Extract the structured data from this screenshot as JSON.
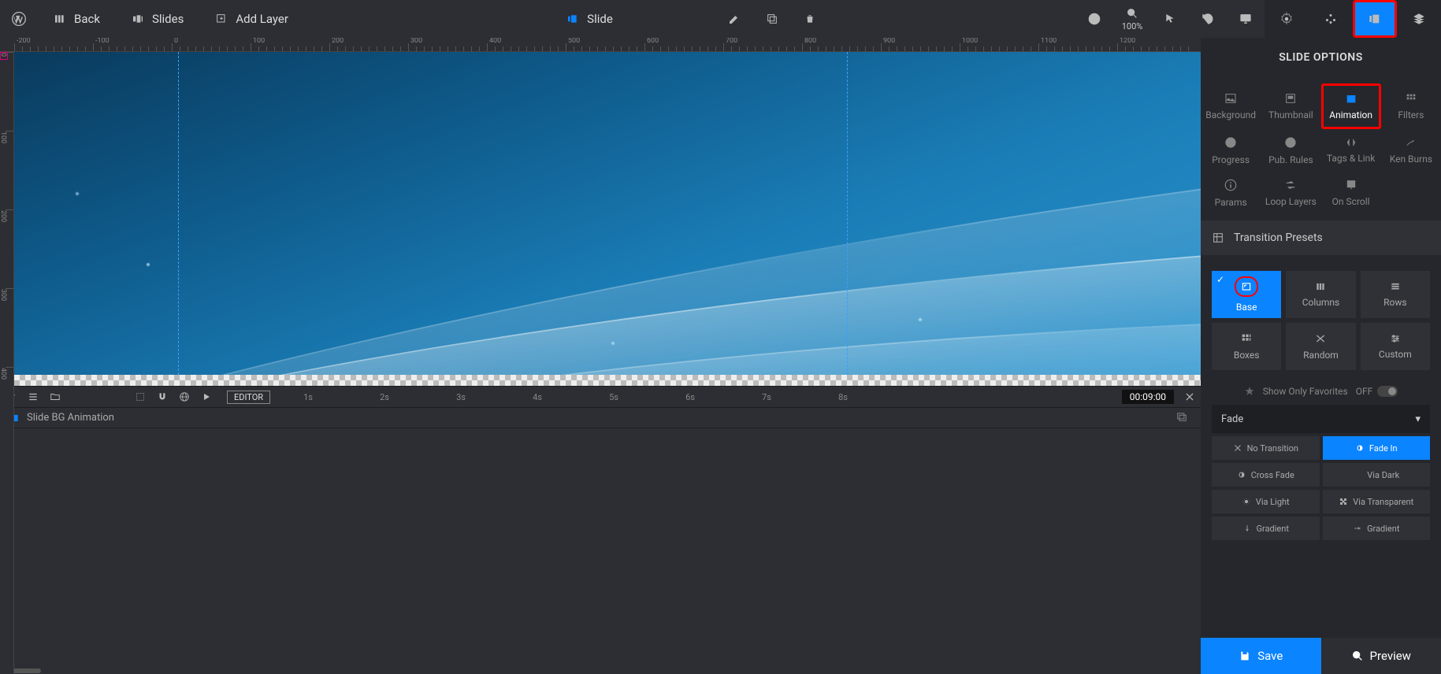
{
  "topbar": {
    "back": "Back",
    "slides": "Slides",
    "addLayer": "Add Layer",
    "slide": "Slide",
    "zoom": "100%"
  },
  "sidePanel": {
    "title": "SLIDE OPTIONS",
    "options": {
      "background": "Background",
      "thumbnail": "Thumbnail",
      "animation": "Animation",
      "filters": "Filters",
      "progress": "Progress",
      "pubRules": "Pub. Rules",
      "tagsLink": "Tags & Link",
      "kenBurns": "Ken Burns",
      "params": "Params",
      "loopLayers": "Loop Layers",
      "onScroll": "On Scroll"
    },
    "transitionHeader": "Transition Presets",
    "presets": {
      "base": "Base",
      "columns": "Columns",
      "rows": "Rows",
      "boxes": "Boxes",
      "random": "Random",
      "custom": "Custom"
    },
    "favLabel": "Show Only Favorites",
    "favToggle": "OFF",
    "fadeGroup": "Fade",
    "fade": {
      "noTransition": "No Transition",
      "fadeIn": "Fade In",
      "crossFade": "Cross Fade",
      "viaDark": "Via Dark",
      "viaLight": "Via Light",
      "viaTransparent": "Via Transparent",
      "gradient1": "Gradient",
      "gradient2": "Gradient"
    },
    "save": "Save",
    "preview": "Preview"
  },
  "timeline": {
    "editor": "EDITOR",
    "seconds": [
      "1s",
      "2s",
      "3s",
      "4s",
      "5s",
      "6s",
      "7s",
      "8s"
    ],
    "time": "00:09:00",
    "track1": "Slide BG Animation"
  },
  "ruler": {
    "h": [
      "-200",
      "-100",
      "0",
      "100",
      "200",
      "300",
      "400",
      "500",
      "600",
      "700",
      "800",
      "900",
      "1000",
      "1100",
      "1200"
    ],
    "v": [
      "0",
      "100",
      "200",
      "300",
      "400"
    ]
  }
}
